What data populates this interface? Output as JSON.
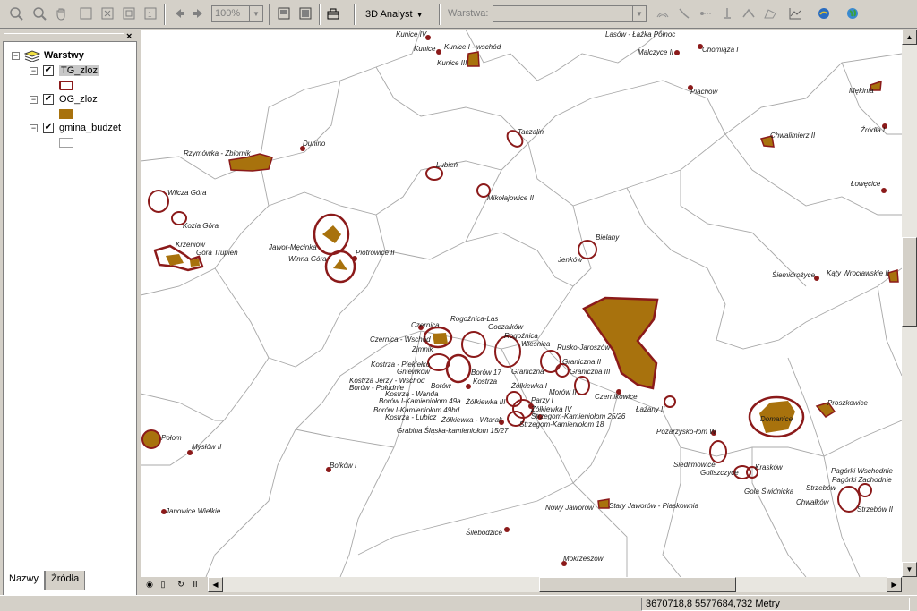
{
  "toolbar": {
    "zoom_value": "100%",
    "analyst_label": "3D Analyst",
    "layer_label": "Warstwa:"
  },
  "toc": {
    "root_label": "Warstwy",
    "layers": [
      {
        "name": "TG_zloz",
        "visible": true,
        "symbol_color": "#8b1a1a",
        "symbol_fill": "#ffffff"
      },
      {
        "name": "OG_zloz",
        "visible": true,
        "symbol_color": "#a8720d",
        "symbol_fill": "#a8720d"
      },
      {
        "name": "gmina_budzet",
        "visible": true,
        "symbol_color": "#a0a0a0",
        "symbol_fill": "#ffffff"
      }
    ],
    "tabs": [
      "Nazwy",
      "Źródła"
    ]
  },
  "status": {
    "coordinates": "3670718,8  5577684,732 Metry"
  },
  "map": {
    "labels": [
      "Kunice IV",
      "Kunice I - wschód",
      "Kunice",
      "Kunice III",
      "Lasów - Łaźka Północ",
      "Malczyce II",
      "Chomiąża I",
      "Piachów",
      "Mękinia",
      "Źródła I",
      "Chwalimierz II",
      "Łowęcice",
      "Taczalin",
      "Dunino",
      "Rzymówka - Zbiornik",
      "Lubień",
      "Mikołajowice II",
      "Wilcza Góra",
      "Kozia Góra",
      "Krzeniów",
      "Góra Trupień",
      "Jawor-Męcinka",
      "Winna Góra",
      "Piotrowice II",
      "Jenków",
      "Bielany",
      "Śiemidrożyce",
      "Kąty Wrocławskie II",
      "Czernica",
      "Rogoźnica-Las",
      "Goczałków",
      "Rogoźnica",
      "Czernica - Wschód",
      "Zimnik",
      "Wieśnica",
      "Rusko-Jaroszów",
      "Kostrza - Piekiełko",
      "Gniewków",
      "Borów 17",
      "Kostrza Jerzy - Wschód",
      "Kostrza",
      "Borów - Południe",
      "Borów",
      "Graniczna",
      "Graniczna II",
      "Graniczna III",
      "Kostrza - Wanda",
      "Żółkiewka I",
      "Morów II",
      "Czernikowice",
      "Borów I-Kamieniołom 49a",
      "Żółkiewka III",
      "Parzy I",
      "Żółkiewka IV",
      "Borów I-Kamieniołom 49bd",
      "Kostrza - Lubicz",
      "Żółkiewka - Wtarak",
      "Strzegom-Kamieniołom 25/26",
      "Strzegom-Kamieniołom 18",
      "Grabina Śląska-kamieniołom 15/27",
      "Łażany II",
      "Proszkowice",
      "Domanice",
      "Pożarzysko-łom W",
      "Połom",
      "Mysłów II",
      "Bolków I",
      "Siedlimowice",
      "Goliszczyce",
      "Krasków",
      "Gola Świdnicka",
      "Pagórki Wschodnie",
      "Pagórki Zachodnie",
      "Strzebów",
      "Chwałków",
      "Strzebów II",
      "Janowice Wielkie",
      "Nowy Jaworów",
      "Stary Jaworów - Piaskownia",
      "Śilebodzice",
      "Mokrzeszów"
    ]
  }
}
